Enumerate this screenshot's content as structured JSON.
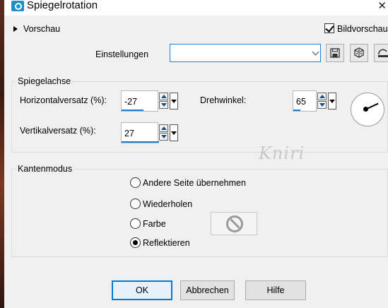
{
  "window": {
    "title": "Spiegelrotation"
  },
  "preview": {
    "label": "Vorschau",
    "bildvorschau_label": "Bildvorschau",
    "bildvorschau_checked": true
  },
  "settings": {
    "label": "Einstellungen",
    "value": "",
    "icons": [
      "save-preset-icon",
      "randomize-icon",
      "reset-icon"
    ]
  },
  "mirror_axis": {
    "group_label": "Spiegelachse",
    "horizontal_label": "Horizontalversatz (%):",
    "horizontal_value": "-27",
    "vertical_label": "Vertikalversatz (%):",
    "vertical_value": "27",
    "rotation_label": "Drehwinkel:",
    "rotation_value": "65"
  },
  "edge_mode": {
    "group_label": "Kantenmodus",
    "options": [
      {
        "label": "Andere Seite übernehmen",
        "selected": false
      },
      {
        "label": "Wiederholen",
        "selected": false
      },
      {
        "label": "Farbe",
        "selected": false
      },
      {
        "label": "Reflektieren",
        "selected": true
      }
    ],
    "color_swatch_icon": "no-color-icon"
  },
  "watermark": "Kniri",
  "buttons": {
    "ok": "OK",
    "cancel": "Abbrechen",
    "help": "Hilfe"
  },
  "colors": {
    "accent": "#0078d7",
    "background": "#f0f0f0",
    "title_icon": "#1e90c8"
  }
}
